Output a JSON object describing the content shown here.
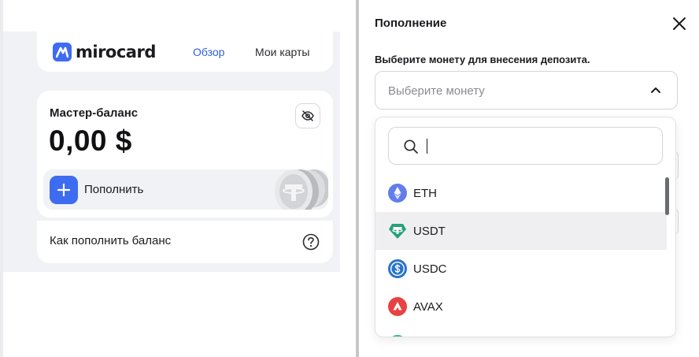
{
  "dashboard": {
    "brand": "mirocard",
    "nav": {
      "overview": "Обзор",
      "my_cards": "Мои карты"
    },
    "balance_title": "Мастер-баланс",
    "balance_amount": "0,00 $",
    "topup_label": "Пополнить",
    "how_to_topup": "Как пополнить баланс"
  },
  "drawer": {
    "title": "Пополнение",
    "field_label": "Выберите монету для внесения депозита.",
    "select_placeholder": "Выберите монету",
    "search_value": "",
    "coins": [
      {
        "symbol": "ETH",
        "color": "#627eea",
        "icon": "eth-icon"
      },
      {
        "symbol": "USDT",
        "color": "#26a17b",
        "icon": "usdt-icon",
        "selected": true
      },
      {
        "symbol": "USDC",
        "color": "#2775ca",
        "icon": "usdc-icon"
      },
      {
        "symbol": "AVAX",
        "color": "#e84142",
        "icon": "avax-icon"
      }
    ],
    "colors": {
      "accent": "#3e6cf0",
      "nav_active": "#2f5fe0"
    }
  }
}
